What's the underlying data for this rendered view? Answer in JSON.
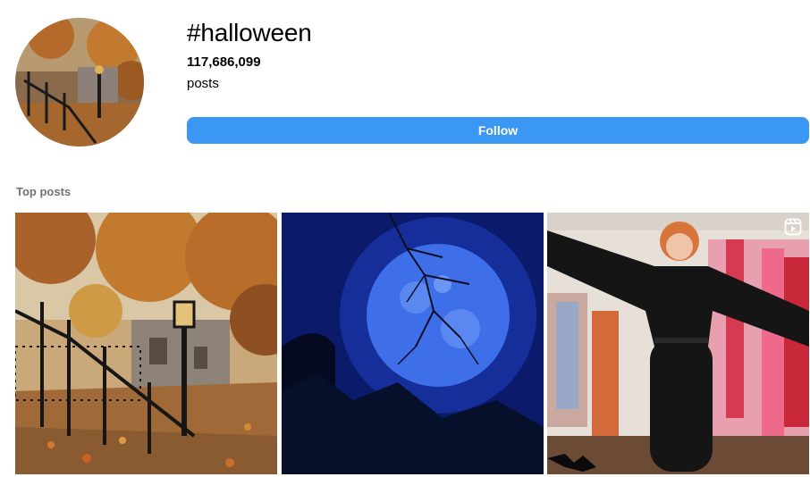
{
  "header": {
    "hashtag": "#halloween",
    "post_count": "117,686,099",
    "post_count_label": "posts",
    "follow_label": "Follow",
    "follow_color": "#3a97f4"
  },
  "top_posts": {
    "label": "Top posts",
    "items": [
      {
        "subject": "autumn stone staircase with lamppost"
      },
      {
        "subject": "full blue moon behind tree branches"
      },
      {
        "subject": "woman in black dress in clothing shop",
        "icon": "reels-icon"
      }
    ]
  }
}
